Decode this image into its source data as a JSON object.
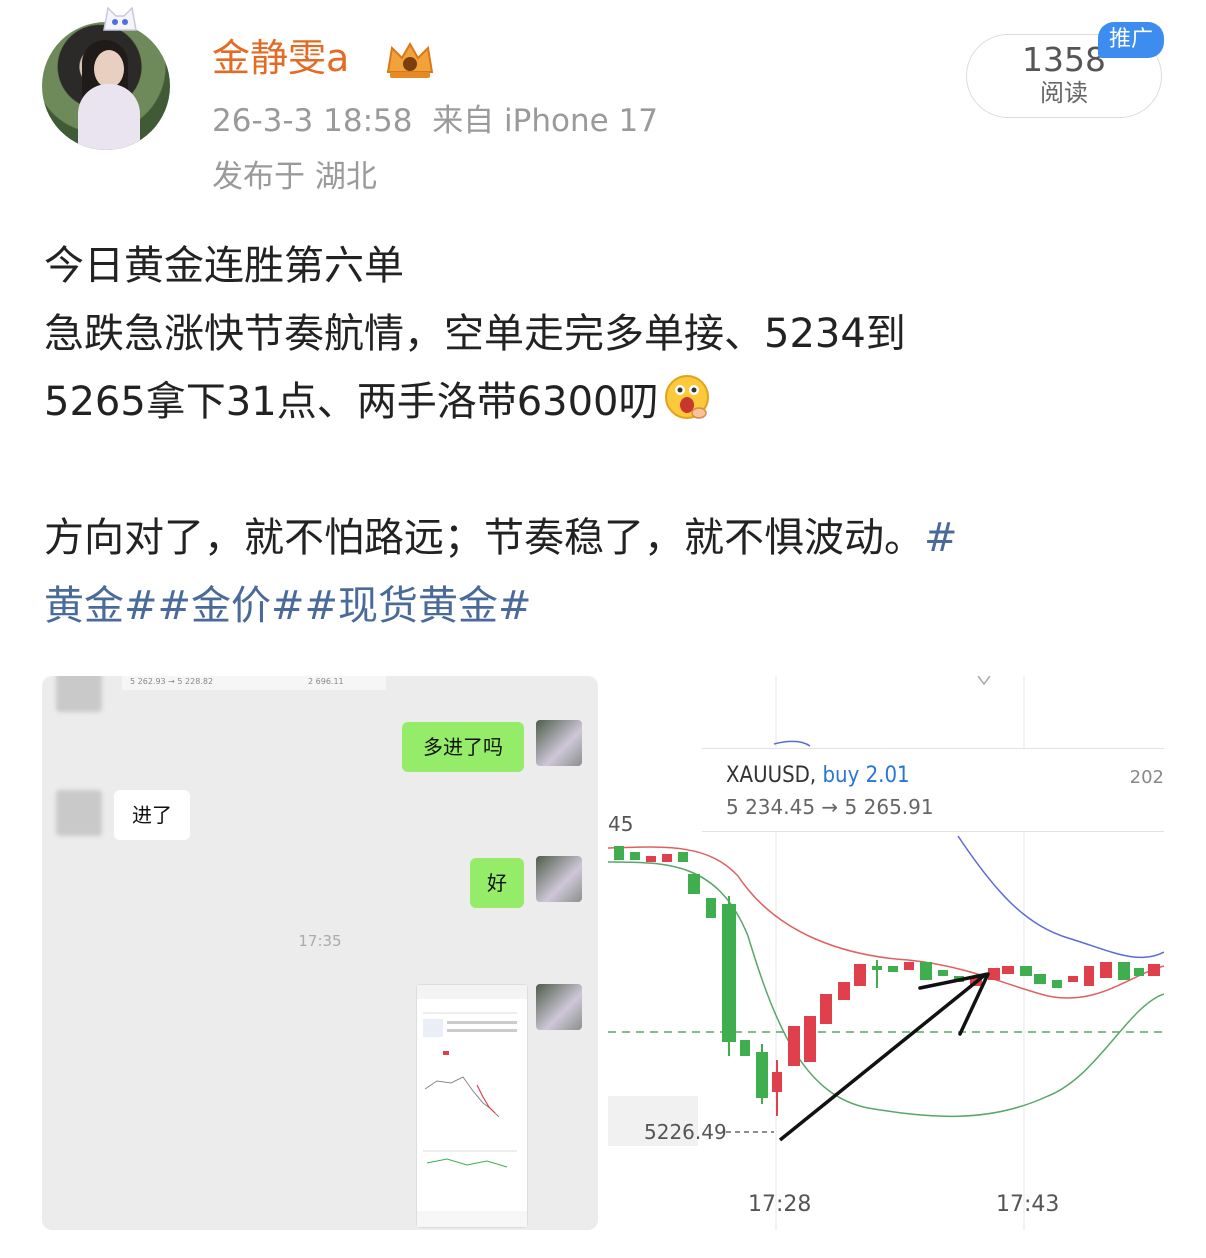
{
  "header": {
    "username": "金静雯a",
    "datetime": "26-3-3 18:58",
    "source": "来自 iPhone 17",
    "location": "发布于 湖北",
    "read_count": "1358",
    "read_label": "阅读",
    "promo_badge": "推广"
  },
  "post": {
    "line1": "今日黄金连胜第六单",
    "line2": "急跌急涨快节奏航情，空单走完多单接、5234到",
    "line3": "5265拿下31点、两手洛带6300叨",
    "line4": "方向对了，就不怕路远；节奏稳了，就不惧波动。",
    "tag_line4": "#",
    "tag_line5": "黄金##金价##现货黄金#",
    "emoji": "surprised-face-emoji"
  },
  "chat_image": {
    "top_strip_left": "5 262.93 → 5 228.82",
    "top_strip_right": "2 696.11",
    "messages": [
      {
        "side": "right",
        "text": "多进了吗"
      },
      {
        "side": "left",
        "text": "进了"
      },
      {
        "side": "right",
        "text": "好"
      }
    ],
    "time": "17:35"
  },
  "chart_image": {
    "symbol": "XAUUSD,",
    "side": "buy 2.01",
    "entry": "5 234.45",
    "arrow": "→",
    "exit": "5 265.91",
    "date_partial": "202",
    "left_partial": "45",
    "low_label": "5226.49",
    "time_left": "17:28",
    "time_right": "17:43",
    "colors": {
      "up": "#e0404b",
      "down": "#3fae4f",
      "ma_red": "#e06060",
      "band_blue": "#5b6bd6",
      "band_green": "#5aa56a"
    }
  }
}
